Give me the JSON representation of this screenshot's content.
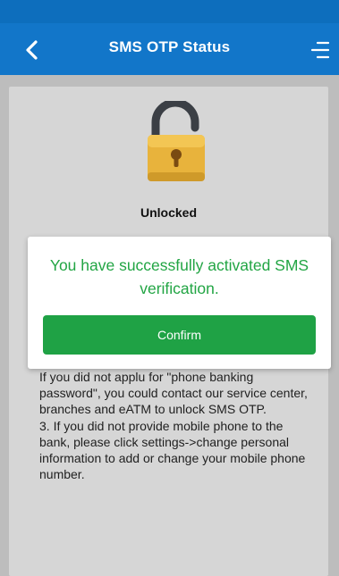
{
  "header": {
    "title": "SMS OTP Status",
    "back_icon": "chevron-left-icon",
    "menu_icon": "menu-lines-icon"
  },
  "status": {
    "lock_icon": "unlocked-padlock-icon",
    "label": "Unlocked"
  },
  "info": {
    "lines": [
      "If you did not applu for \"phone banking password\", you could contact our service center, branches and eATM to unlock SMS OTP.",
      "3. If you did not provide mobile phone to the bank, please click settings->change personal information to add or change your mobile phone number."
    ]
  },
  "dialog": {
    "message": "You have successfully activated SMS verification.",
    "confirm_label": "Confirm"
  },
  "colors": {
    "header": "#1276c9",
    "success_text": "#22a544",
    "confirm_button": "#1fa245",
    "lock_gold": "#e8b33c"
  }
}
